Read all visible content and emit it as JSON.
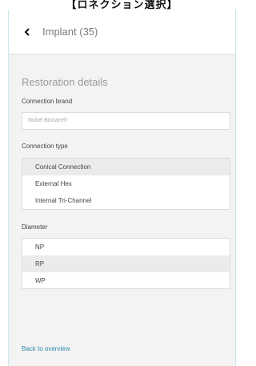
{
  "caption": "【ロネクション選択】",
  "header": {
    "title": "Implant (35)"
  },
  "restoration": {
    "title": "Restoration details",
    "brand_label": "Connection brand",
    "brand_value": "Nobel Biocare®",
    "type_label": "Connection type",
    "types": [
      {
        "label": "Conical Connection",
        "selected": true
      },
      {
        "label": "External Hex",
        "selected": false
      },
      {
        "label": "Internal Tri-Channel",
        "selected": false
      }
    ],
    "diameter_label": "Diameter",
    "diameters": [
      {
        "label": "NP",
        "selected": false
      },
      {
        "label": "RP",
        "selected": true
      },
      {
        "label": "WP",
        "selected": false
      }
    ]
  },
  "footer": {
    "back_link": "Back to overview"
  },
  "colors": {
    "accent": "#2f8ab0",
    "selected_bg": "#ebebeb",
    "panel_bg": "#f3f3f3"
  }
}
